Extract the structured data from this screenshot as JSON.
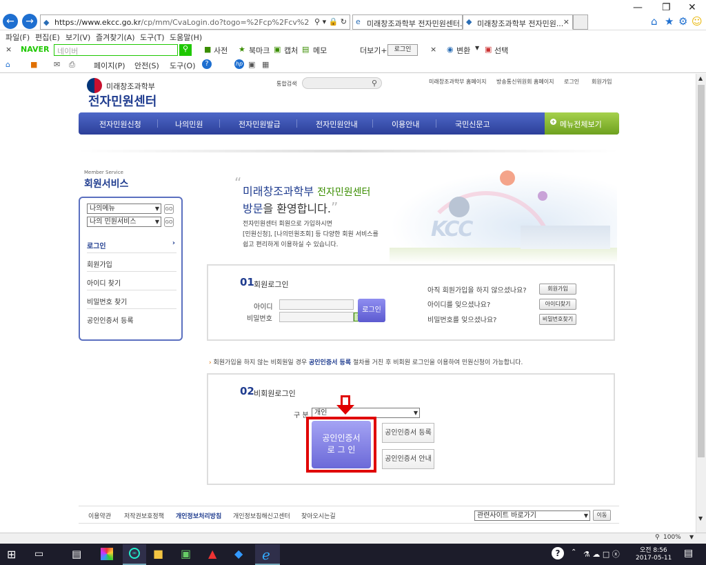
{
  "browser": {
    "url_host": "https://www.ekcc.go.kr",
    "url_path": "/cp/mm/CvaLogin.do?togo=%2Fcp%2Fcv%2FCp1440000_007",
    "tabs": [
      {
        "label": "미래창조과학부 전자민원센터..."
      },
      {
        "label": "미래창조과학부 전자민원..."
      }
    ],
    "menu": [
      "파일(F)",
      "편집(E)",
      "보기(V)",
      "즐겨찾기(A)",
      "도구(T)",
      "도움말(H)"
    ],
    "naver": {
      "logo": "NAVER",
      "search_placeholder": "네이버",
      "items": [
        "사전",
        "북마크",
        "캡처",
        "메모"
      ],
      "more": "더보기+",
      "login": "로그인",
      "convert": "변환",
      "select": "선택"
    },
    "cmd": [
      "페이지(P)",
      "안전(S)",
      "도구(O)"
    ],
    "zoom": "100%"
  },
  "site": {
    "ministry": "미래창조과학부",
    "title": "전자민원센터",
    "search_label": "통합검색",
    "top_links": [
      "미래창조과학부 홈페이지",
      "방송통신위원회 홈페이지",
      "로그인",
      "회원가입"
    ],
    "nav": [
      "전자민원신청",
      "나의민원",
      "전자민원발급",
      "전자민원안내",
      "이용안내",
      "국민신문고"
    ],
    "menu_all": "메뉴전체보기",
    "side_sub": "Member Service",
    "side_title": "회원서비스",
    "side_select1": "나의메뉴",
    "side_select2": "나의 민원서비스",
    "go": "GO",
    "side_items": [
      "로그인",
      "회원가입",
      "아이디 찾기",
      "비밀번호 찾기",
      "공인인증서 등록"
    ],
    "welcome_1": "미래창조과학부",
    "welcome_2": "전자민원센터",
    "welcome_3": "방문",
    "welcome_4": "을 환영합니다.",
    "welcome_desc": [
      "전자민원센터 회원으로 가입하시면",
      "[민원신청], [나의민원조회] 등 다양한 회원 서비스를",
      "쉽고 편리하게 이용하실 수 있습니다."
    ],
    "banner_text": "KCC",
    "member_login": {
      "num": "01",
      "title": "회원로그인",
      "id_label": "아이디",
      "pw_label": "비밀번호",
      "login_btn": "로그인",
      "q1": "아직 회원가입을 하지 않으셨나요?",
      "q2": "아이디를 잊으셨나요?",
      "q3": "비밀번호를 잊으셨나요?",
      "b1": "회원가입",
      "b2": "아이디찾기",
      "b3": "비밀번호찾기"
    },
    "notice_pre": "회원가입을 하지 않는 비회원일 경우 ",
    "notice_link": "공인인증서 등록",
    "notice_post": " 절차를 거친 후 비회원 로그인을 이용하여 민원신청이 가능합니다.",
    "guest_login": {
      "num": "02",
      "title": "비회원로그인",
      "type_label": "구 분",
      "type_value": "개인",
      "cert_login_1": "공인인증서",
      "cert_login_2": "로 그 인",
      "cert_register": "공인인증서 등록",
      "cert_guide": "공인인증서 안내"
    },
    "footer_links": [
      "이용약관",
      "저작권보호정책",
      "개인정보처리방침",
      "개인정보침해신고센터",
      "찾아오시는길"
    ],
    "related_select": "관련사이트 바로가기",
    "move_btn": "이동"
  },
  "taskbar": {
    "time": "오전 8:56",
    "date": "2017-05-11"
  },
  "colors": {
    "accent": "#2c3f99",
    "highlight": "#e00000",
    "cert_btn": "#7a78e0"
  }
}
